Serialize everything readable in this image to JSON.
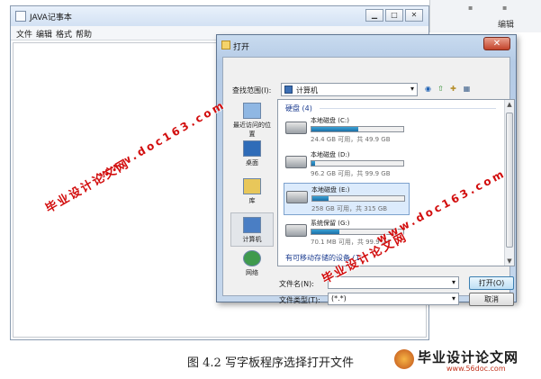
{
  "notepad": {
    "title": "JAVA记事本",
    "menu": [
      "文件",
      "编辑",
      "格式",
      "帮助"
    ],
    "minimize": "▁",
    "maximize": "□",
    "close": "✕"
  },
  "background_window": {
    "label": "编辑"
  },
  "dialog": {
    "title": "打开",
    "close": "✕",
    "look_in_label": "查找范围(I):",
    "look_in_value": "计算机",
    "places": [
      {
        "label": "最近访问的位置",
        "icon": "recent-places-icon"
      },
      {
        "label": "桌面",
        "icon": "desktop-icon"
      },
      {
        "label": "库",
        "icon": "libraries-icon"
      },
      {
        "label": "计算机",
        "icon": "computer-icon"
      },
      {
        "label": "网络",
        "icon": "network-icon"
      }
    ],
    "groups": {
      "hdd": "硬盘 (4)",
      "removable": "有可移动存储的设备 (1)"
    },
    "drives": [
      {
        "name": "本地磁盘 (C:)",
        "info": "24.4 GB 可用，共 49.9 GB",
        "used_fraction": 0.51
      },
      {
        "name": "本地磁盘 (D:)",
        "info": "96.2 GB 可用，共 99.9 GB",
        "used_fraction": 0.04
      },
      {
        "name": "本地磁盘 (E:)",
        "info": "258 GB 可用，共 315 GB",
        "used_fraction": 0.18
      },
      {
        "name": "系统保留 (G:)",
        "info": "70.1 MB 可用，共 99.9 MB",
        "used_fraction": 0.3
      }
    ],
    "file_name_label": "文件名(N):",
    "file_name_value": "",
    "file_type_label": "文件类型(T):",
    "file_type_value": "(*.*)",
    "open_button": "打开(O)",
    "cancel_button": "取消"
  },
  "watermarks": {
    "site_cn": "毕业设计论文网",
    "site_url": "www.doc163.com"
  },
  "caption": "图 4.2   写字板程序选择打开文件",
  "logo": {
    "name": "毕业设计论文网",
    "url": "www.56doc.com"
  }
}
